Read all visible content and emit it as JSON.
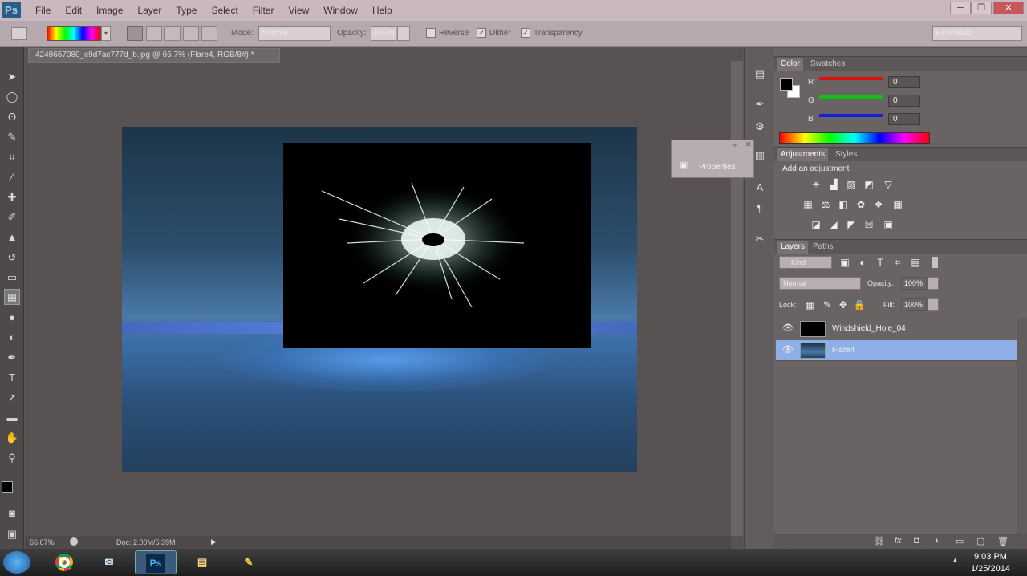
{
  "app": {
    "logo": "Ps"
  },
  "menu": [
    "File",
    "Edit",
    "Image",
    "Layer",
    "Type",
    "Select",
    "Filter",
    "View",
    "Window",
    "Help"
  ],
  "window_controls": [
    "─",
    "❐",
    "✕"
  ],
  "options": {
    "mode_label": "Mode:",
    "mode_value": "Normal",
    "opacity_label": "Opacity:",
    "opacity_value": "100%",
    "reverse_label": "Reverse",
    "dither_label": "Dither",
    "transparency_label": "Transparency",
    "workspace_value": "Essentials"
  },
  "document": {
    "tab_title": "4249657080_c9d7ac777d_b.jpg @ 66.7% (Flare4, RGB/8#) *",
    "zoom": "66.67%",
    "doc_size": "Doc: 2.00M/5.39M"
  },
  "properties_float": {
    "label": "Properties"
  },
  "color_panel": {
    "tabs": [
      "Color",
      "Swatches"
    ],
    "channels": [
      {
        "label": "R",
        "value": "0",
        "color": "#e01010"
      },
      {
        "label": "G",
        "value": "0",
        "color": "#10c010"
      },
      {
        "label": "B",
        "value": "0",
        "color": "#1020e0"
      }
    ]
  },
  "adjustments_panel": {
    "tabs": [
      "Adjustments",
      "Styles"
    ],
    "heading": "Add an adjustment"
  },
  "layers_panel": {
    "tabs": [
      "Layers",
      "Paths"
    ],
    "kind_value": "Kind",
    "blend_value": "Normal",
    "opacity_label": "Opacity:",
    "opacity_value": "100%",
    "lock_label": "Lock:",
    "fill_label": "Fill:",
    "fill_value": "100%",
    "layers": [
      {
        "name": "Windshield_Hole_04",
        "selected": false
      },
      {
        "name": "Flare4",
        "selected": true
      }
    ]
  },
  "taskbar": {
    "time": "9:03 PM",
    "date": "1/25/2014",
    "apps": [
      "chrome-icon",
      "outlook-icon",
      "photoshop-icon",
      "explorer-icon",
      "paint-icon"
    ]
  }
}
